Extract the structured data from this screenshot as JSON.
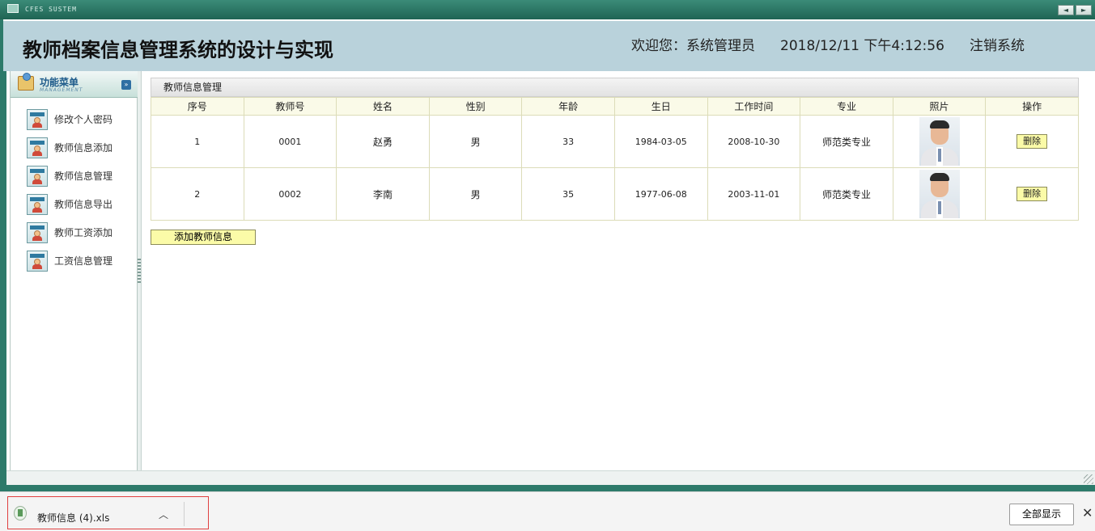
{
  "window": {
    "app_title": "CFES SUSTEM",
    "nav_prev": "◄",
    "nav_next": "►"
  },
  "header": {
    "title": "教师档案信息管理系统的设计与实现",
    "welcome": "欢迎您：系统管理员",
    "datetime": "2018/12/11 下午4:12:56",
    "logout": "注销系统"
  },
  "sidebar": {
    "menu_title": "功能菜单",
    "menu_subtitle": "MANAGEMENT",
    "items": [
      {
        "label": "修改个人密码"
      },
      {
        "label": "教师信息添加"
      },
      {
        "label": "教师信息管理"
      },
      {
        "label": "教师信息导出"
      },
      {
        "label": "教师工资添加"
      },
      {
        "label": "工资信息管理"
      }
    ]
  },
  "main": {
    "panel_title": "教师信息管理",
    "columns": [
      "序号",
      "教师号",
      "姓名",
      "性别",
      "年龄",
      "生日",
      "工作时间",
      "专业",
      "照片",
      "操作"
    ],
    "rows": [
      {
        "seq": "1",
        "teacher_no": "0001",
        "name": "赵勇",
        "gender": "男",
        "age": "33",
        "birthday": "1984-03-05",
        "work_date": "2008-10-30",
        "major": "师范类专业",
        "action": "删除"
      },
      {
        "seq": "2",
        "teacher_no": "0002",
        "name": "李南",
        "gender": "男",
        "age": "35",
        "birthday": "1977-06-08",
        "work_date": "2003-11-01",
        "major": "师范类专业",
        "action": "删除"
      }
    ],
    "add_button": "添加教师信息"
  },
  "download_bar": {
    "file_name": "教师信息 (4).xls",
    "show_all": "全部显示",
    "close": "✕",
    "chevron": "^"
  }
}
